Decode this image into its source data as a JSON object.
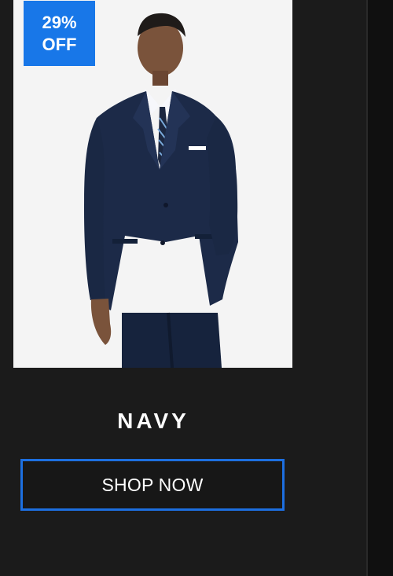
{
  "product": {
    "discount_badge_line1": "29%",
    "discount_badge_line2": "OFF",
    "color_name": "NAVY",
    "cta_label": "SHOP NOW"
  },
  "colors": {
    "badge": "#1877e8",
    "button_border": "#1d6fe0",
    "background": "#1b1b1b",
    "image_bg": "#f4f4f4",
    "suit": "#1c2a48"
  },
  "icons": {
    "product_image": "navy-suit-model"
  }
}
